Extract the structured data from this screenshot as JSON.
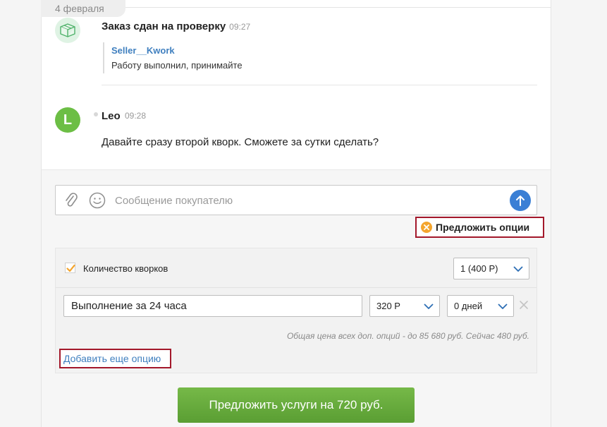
{
  "date_divider": "4 февраля",
  "order_message": {
    "title": "Заказ сдан на проверку",
    "time": "09:27",
    "quote_author": "Seller__Kwork",
    "quote_text": "Работу выполнил, принимайте",
    "icon": "package-icon"
  },
  "buyer_message": {
    "avatar_letter": "L",
    "author": "Leo",
    "time": "09:28",
    "text": "Давайте сразу второй кворк. Сможете за сутки сделать?"
  },
  "composer": {
    "placeholder": "Сообщение покупателю",
    "value": ""
  },
  "offer_options_label": "Предложить опции",
  "options": {
    "quantity_label": "Количество кворков",
    "quantity_checked": true,
    "quantity_select": "1 (400 Р)",
    "option_name": "Выполнение за 24 часа",
    "option_price": "320 Р",
    "option_days": "0 дней",
    "total_note": "Общая цена всех доп. опций - до 85 680 руб. Сейчас 480 руб.",
    "add_option_label": "Добавить еще опцию"
  },
  "submit_label": "Предложить услуги на 720 руб.",
  "colors": {
    "accent_blue": "#3a7fd5",
    "link_blue": "#3f7fbf",
    "green": "#6cbe45",
    "highlight_red": "#a3182b",
    "checkbox_orange": "#f4a52e"
  }
}
